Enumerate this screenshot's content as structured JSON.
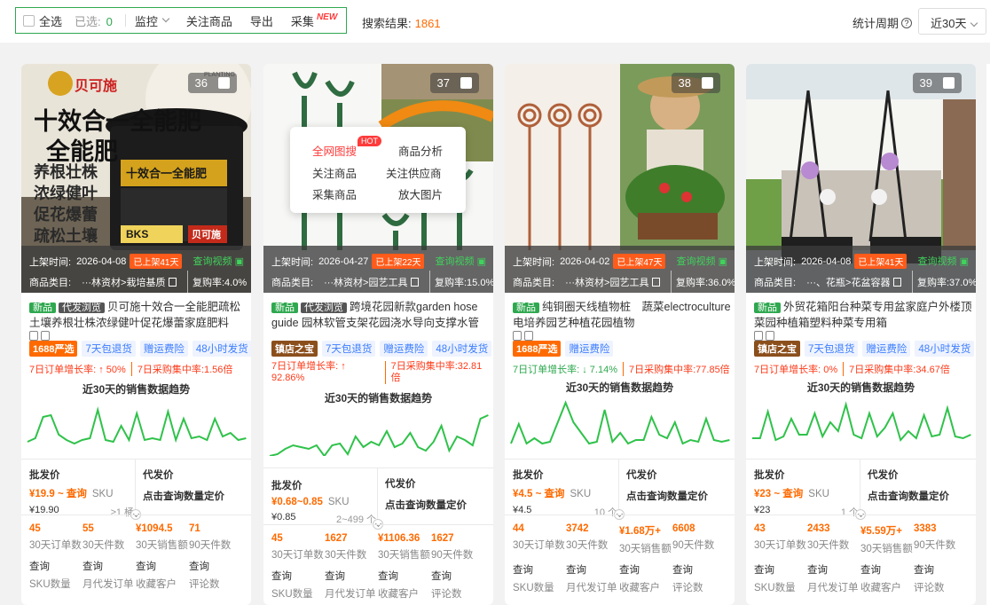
{
  "toolbar": {
    "select_all": "全选",
    "selected_label": "已选:",
    "selected_count": "0",
    "monitor": "监控",
    "follow": "关注商品",
    "export": "导出",
    "collect": "采集",
    "new_badge": "NEW",
    "result_label": "搜索结果:",
    "result_count": "1861",
    "period_label": "统计周期",
    "period_help": "?",
    "period_value": "近30天"
  },
  "popup": {
    "search_all": "全网图搜",
    "hot": "HOT",
    "analysis": "商品分析",
    "follow": "关注商品",
    "follow_supplier": "关注供应商",
    "collect": "采集商品",
    "enlarge": "放大图片"
  },
  "common": {
    "listed_label": "上架时间:",
    "video_link": "查询视频",
    "category_label": "商品类目:",
    "tag_new": "新品",
    "tag_dropship": "代发浏览",
    "trend_title": "近30天的销售数据趋势",
    "wholesale_label": "批发价",
    "dropship_label": "代发价",
    "dropship_action": "点击查询数量定价",
    "sku_label": "SKU",
    "query": "查询",
    "k1": "30天订单数",
    "k2": "30天件数",
    "k3": "30天销售额",
    "k4": "90天件数",
    "q1": "SKU数量",
    "q2": "月代发订单",
    "q3": "收藏客户",
    "q4": "评论数"
  },
  "cards": [
    {
      "rank": "36",
      "listed": "2026-04-08",
      "listed_days": "已上架41天",
      "category": "···林资材>栽培基质",
      "repurchase": "复购率:4.0%",
      "title": "贝可施十效合一全能肥疏松土壤养根壮株浓绿健叶促花爆蕾家庭肥料",
      "badge": "1688严选",
      "badge_color": "#ff6a00",
      "labels": [
        "7天包退货",
        "赠运费险",
        "48小时发货"
      ],
      "growth_order": "7日订单增长率: ↑ 50%",
      "growth_buy": "7日采购集中率:1.56倍",
      "price": "¥19.9 ~ 查询",
      "price_unit": "SKU",
      "price_base": "¥19.90",
      "moq": "≥1 桶",
      "stats": [
        "45",
        "55",
        "¥1094.5",
        "71"
      ],
      "image_text": {
        "brand": "贝可施",
        "headline": "十效合一全能肥",
        "lines": [
          "养根壮株",
          "浓绿健叶",
          "促花爆蕾",
          "疏松土壤"
        ],
        "bucket": "十效合一全能肥",
        "bks": "BKS",
        "corner": "PLANTING"
      }
    },
    {
      "rank": "37",
      "listed": "2026-04-27",
      "listed_days": "已上架22天",
      "category": "···林资材>园艺工具",
      "repurchase": "复购率:15.0%",
      "title": "跨境花园新款garden hose guide 园林软管支架花园浇水导向支撑水管架",
      "badge": "镇店之宝",
      "badge_color": "#8b4f1c",
      "labels": [
        "7天包退货",
        "赠运费险",
        "48小时发货"
      ],
      "growth_order": "7日订单增长率: ↑ 92.86%",
      "growth_buy": "7日采购集中率:32.81倍",
      "price": "¥0.68~0.85",
      "price_unit": "SKU",
      "price_base": "¥0.85",
      "moq": "2~499 个",
      "stats": [
        "45",
        "1627",
        "¥1106.36",
        "1627"
      ]
    },
    {
      "rank": "38",
      "listed": "2026-04-02",
      "listed_days": "已上架47天",
      "category": "···林资材>园艺工具",
      "repurchase": "复购率:36.0%",
      "title": "纯铜圈天线植物桩　蔬菜electroculture 电培养园艺种植花园植物",
      "badge": "1688严选",
      "badge_color": "#ff6a00",
      "labels": [
        "赠运费险"
      ],
      "growth_order": "7日订单增长率: ↓ 7.14%",
      "growth_buy": "7日采购集中率:77.85倍",
      "price": "¥4.5 ~ 查询",
      "price_unit": "SKU",
      "price_base": "¥4.5",
      "moq": "10 个",
      "stats": [
        "44",
        "3742",
        "¥1.68万+",
        "6608"
      ]
    },
    {
      "rank": "39",
      "listed": "2026-04-08",
      "listed_days": "已上架41天",
      "category": "···、花瓶>花盆容器",
      "repurchase": "复购率:37.0%",
      "title": "外贸花箱阳台种菜专用盆家庭户外楼顶菜园种植箱塑料种菜专用箱",
      "badge": "镇店之宝",
      "badge_color": "#8b4f1c",
      "labels": [
        "7天包退货",
        "赠运费险",
        "48小时发货"
      ],
      "growth_order": "7日订单增长率: 0%",
      "growth_buy": "7日采购集中率:34.67倍",
      "price": "¥23 ~ 查询",
      "price_unit": "SKU",
      "price_base": "¥23",
      "moq": "1 个",
      "stats": [
        "43",
        "2433",
        "¥5.59万+",
        "3383"
      ]
    }
  ],
  "colors": {
    "accent_green": "#2fa84f",
    "price_orange": "#ff6a00",
    "alert_red": "#ff3b1a",
    "link_blue": "#3b7cff"
  }
}
